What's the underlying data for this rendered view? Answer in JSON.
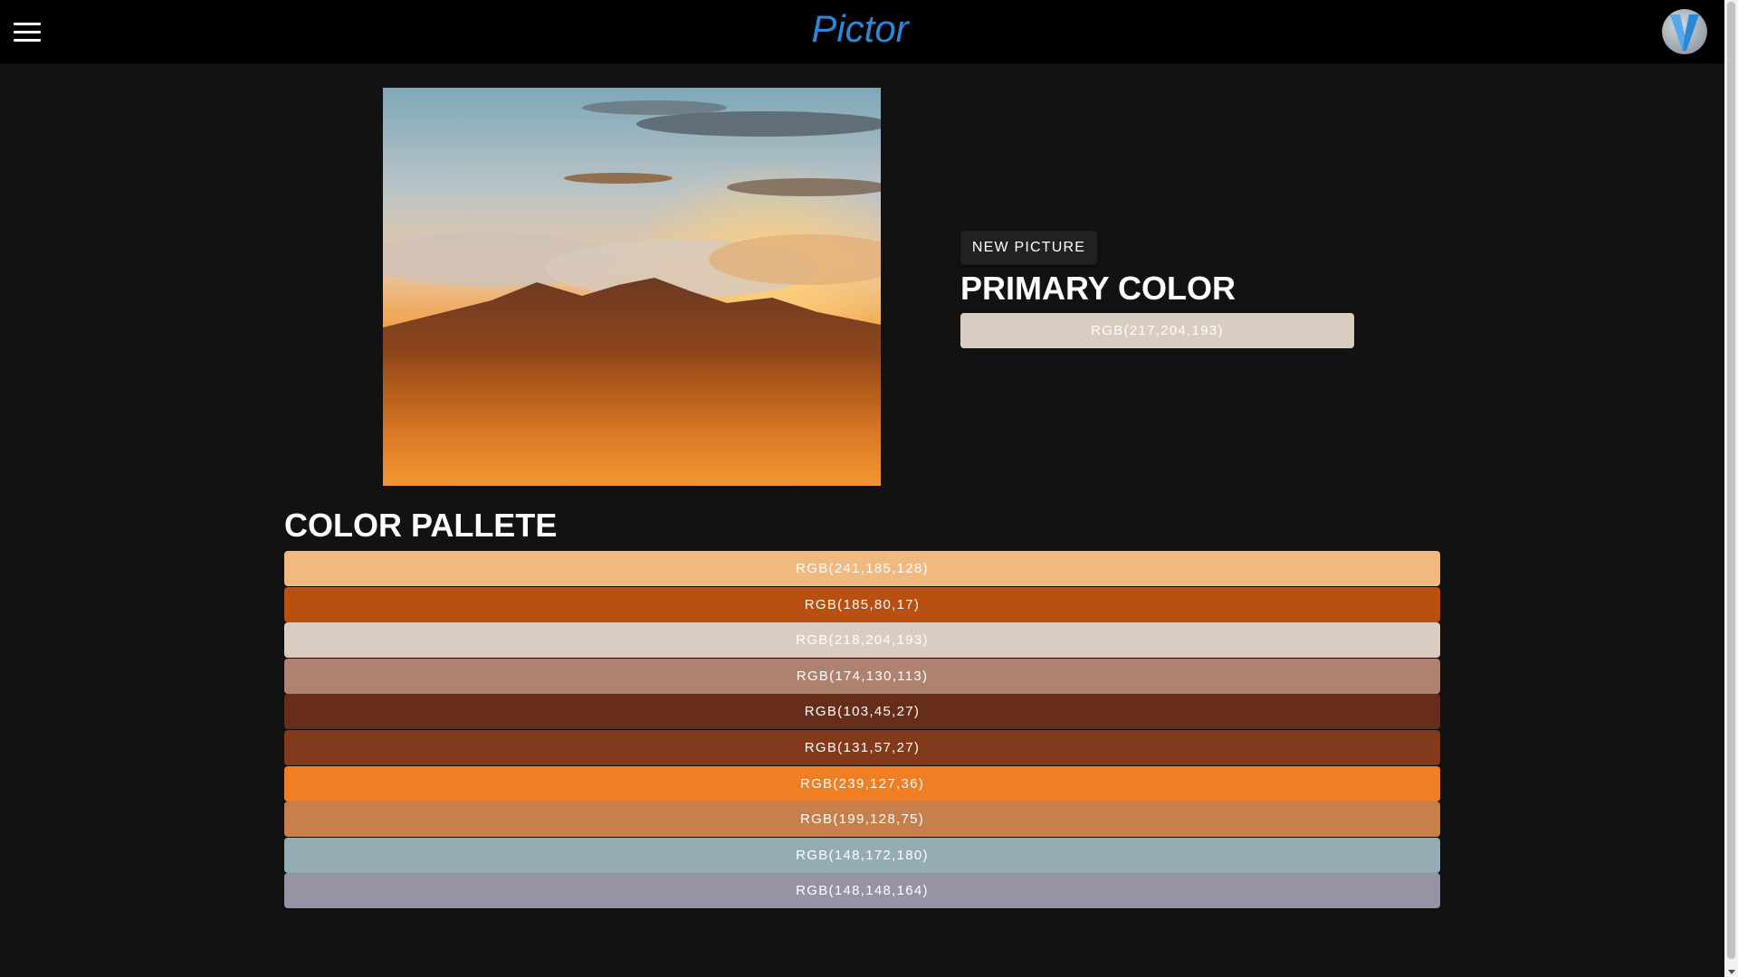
{
  "header": {
    "brand": "Pictor",
    "brand_color": "#2c87d8",
    "menu_icon": "hamburger-menu-icon",
    "avatar_icon": "v-logo-avatar-icon"
  },
  "picture": {
    "subject": "sunset over mountains and clouds"
  },
  "actions": {
    "new_picture_label": "NEW PICTURE"
  },
  "primary": {
    "title": "PRIMARY COLOR",
    "label": "RGB(217,204,193)",
    "color": "#d9ccc1"
  },
  "palette": {
    "title": "COLOR PALLETE",
    "swatches": [
      {
        "label": "RGB(241,185,128)",
        "color": "#f1b980"
      },
      {
        "label": "RGB(185,80,17)",
        "color": "#b95011"
      },
      {
        "label": "RGB(218,204,193)",
        "color": "#daccc1"
      },
      {
        "label": "RGB(174,130,113)",
        "color": "#ae8271"
      },
      {
        "label": "RGB(103,45,27)",
        "color": "#672d1b"
      },
      {
        "label": "RGB(131,57,27)",
        "color": "#83391b"
      },
      {
        "label": "RGB(239,127,36)",
        "color": "#ef7f24"
      },
      {
        "label": "RGB(199,128,75)",
        "color": "#c7804b"
      },
      {
        "label": "RGB(148,172,180)",
        "color": "#94acb4"
      },
      {
        "label": "RGB(148,148,164)",
        "color": "#9494a4"
      }
    ]
  }
}
